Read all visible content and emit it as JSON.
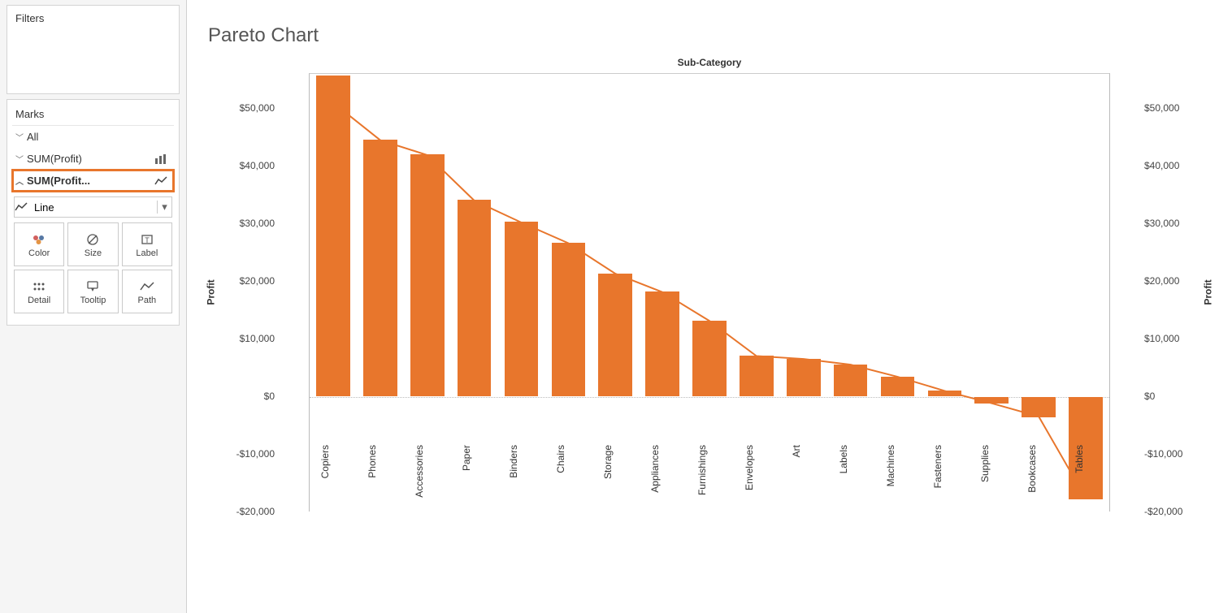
{
  "sidebar": {
    "filters_title": "Filters",
    "marks_title": "Marks",
    "items": [
      {
        "label": "All",
        "type": ""
      },
      {
        "label": "SUM(Profit)",
        "type": "bar"
      },
      {
        "label": "SUM(Profit...",
        "type": "line"
      }
    ],
    "mark_type_label": "Line",
    "buttons": {
      "color": "Color",
      "size": "Size",
      "label": "Label",
      "detail": "Detail",
      "tooltip": "Tooltip",
      "path": "Path"
    }
  },
  "chart": {
    "title": "Pareto Chart",
    "x_title": "Sub-Category",
    "y_label_left": "Profit",
    "y_label_right": "Profit",
    "y_ticks": [
      "$50,000",
      "$40,000",
      "$30,000",
      "$20,000",
      "$10,000",
      "$0",
      "-$10,000",
      "-$20,000"
    ],
    "y_min": -20000,
    "y_max": 56000,
    "bar_color": "#e8762c"
  },
  "chart_data": {
    "type": "bar+line",
    "title": "Pareto Chart",
    "xlabel": "Sub-Category",
    "ylabel": "Profit",
    "ylim": [
      -20000,
      56000
    ],
    "categories": [
      "Copiers",
      "Phones",
      "Accessories",
      "Paper",
      "Binders",
      "Chairs",
      "Storage",
      "Appliances",
      "Furnishings",
      "Envelopes",
      "Art",
      "Labels",
      "Machines",
      "Fasteners",
      "Supplies",
      "Bookcases",
      "Tables"
    ],
    "series": [
      {
        "name": "SUM(Profit) bars",
        "type": "bar",
        "values": [
          55600,
          44500,
          41900,
          34000,
          30200,
          26600,
          21300,
          18100,
          13100,
          7000,
          6500,
          5500,
          3400,
          950,
          -1200,
          -3500,
          -17700
        ]
      },
      {
        "name": "SUM(Profit) line",
        "type": "line",
        "values": [
          51000,
          44500,
          41900,
          34000,
          30200,
          26600,
          21300,
          18100,
          13100,
          7000,
          6500,
          5500,
          3400,
          950,
          -1200,
          -3500,
          -17700
        ]
      }
    ]
  }
}
